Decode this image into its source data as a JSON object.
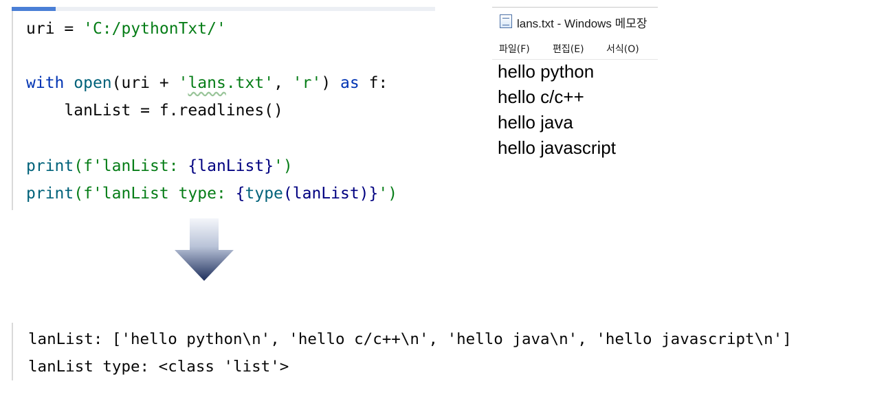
{
  "editor": {
    "lines": [
      [
        "uri = ",
        "'C:/pythonTxt/'"
      ],
      [
        "with",
        " ",
        "open",
        "(uri + ",
        "'",
        "lans",
        ".txt'",
        ", ",
        "'r'",
        ") ",
        "as",
        " f:"
      ],
      [
        "    lanList = f.readlines()"
      ],
      [
        "print",
        "(f'lanList: ",
        "{lanList}",
        "')"
      ],
      [
        "print",
        "(f'lanList type: ",
        "{",
        "type",
        "(lanList)",
        "}",
        "')"
      ]
    ]
  },
  "notepad": {
    "title": "lans.txt - Windows 메모장",
    "menu": [
      "파일(F)",
      "편집(E)",
      "서식(O)"
    ],
    "lines": [
      "hello python",
      "hello c/c++",
      "hello java",
      "hello javascript"
    ]
  },
  "output": {
    "lines": [
      "lanList: ['hello python\\n', 'hello c/c++\\n', 'hello java\\n', 'hello javascript\\n']",
      "lanList type: <class 'list'>"
    ]
  },
  "colors": {
    "keyword": "#0033b3",
    "string": "#067d17",
    "builtin": "#000080",
    "arrow_top": "#f4f6fa",
    "arrow_bottom": "#1e2f5c"
  }
}
